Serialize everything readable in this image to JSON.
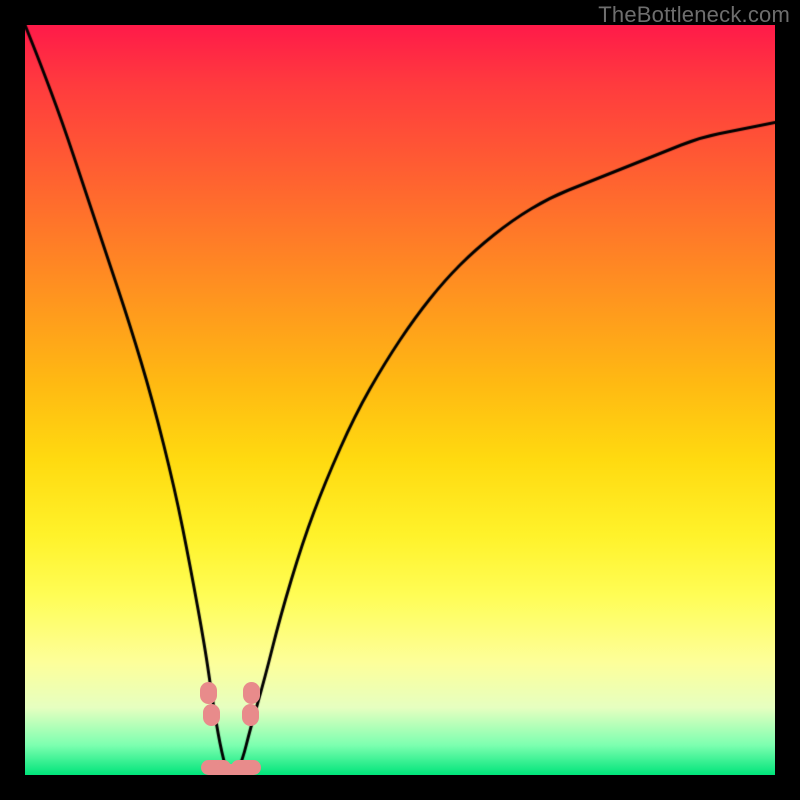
{
  "watermark": {
    "text": "TheBottleneck.com"
  },
  "colors": {
    "curve": "#000000",
    "marker": "#e88b8b",
    "frame": "#000000"
  },
  "chart_data": {
    "type": "line",
    "title": "",
    "xlabel": "",
    "ylabel": "",
    "xlim": [
      0,
      100
    ],
    "ylim": [
      0,
      100
    ],
    "grid": false,
    "legend": false,
    "note": "Bottleneck-style curve: y-values are approximate bottleneck percentage read from vertical position within the gradient (0 at bottom/green, 100 at top/red). Curve minimum ≈ x=27 where y≈0.",
    "x": [
      0,
      2,
      5,
      8,
      11,
      14,
      17,
      20,
      22,
      24,
      25,
      26,
      27,
      28,
      29,
      30,
      32,
      34,
      37,
      40,
      44,
      48,
      52,
      56,
      60,
      65,
      70,
      75,
      80,
      85,
      90,
      95,
      100
    ],
    "values": [
      100,
      95,
      87,
      78,
      69,
      60,
      50,
      38,
      28,
      17,
      10,
      4,
      0,
      0,
      2,
      6,
      13,
      21,
      31,
      39,
      48,
      55,
      61,
      66,
      70,
      74,
      77,
      79,
      81,
      83,
      85,
      86,
      87
    ],
    "markers": [
      {
        "name": "left-shoulder-top",
        "x": 24.5,
        "y": 11
      },
      {
        "name": "left-shoulder-bottom",
        "x": 24.8,
        "y": 8
      },
      {
        "name": "right-shoulder-top",
        "x": 30.2,
        "y": 11
      },
      {
        "name": "right-shoulder-bottom",
        "x": 30.0,
        "y": 8
      },
      {
        "name": "trough-left",
        "x": 25.5,
        "y": 1
      },
      {
        "name": "trough-mid",
        "x": 27.5,
        "y": 0.5
      },
      {
        "name": "trough-right",
        "x": 29.5,
        "y": 1
      }
    ]
  }
}
